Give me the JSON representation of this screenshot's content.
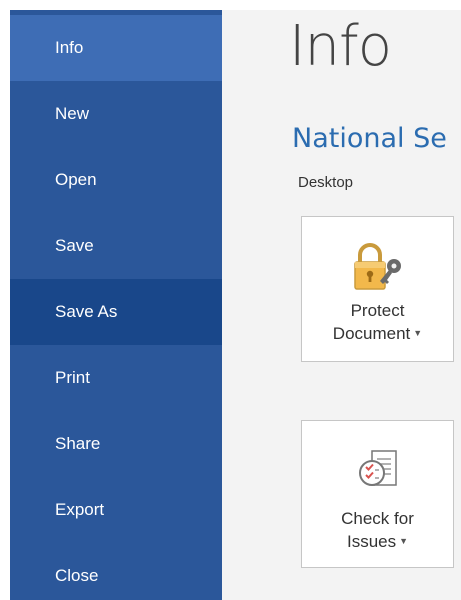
{
  "sidebar": {
    "items": [
      {
        "label": "Info"
      },
      {
        "label": "New"
      },
      {
        "label": "Open"
      },
      {
        "label": "Save"
      },
      {
        "label": "Save As"
      },
      {
        "label": "Print"
      },
      {
        "label": "Share"
      },
      {
        "label": "Export"
      },
      {
        "label": "Close"
      }
    ],
    "active_index": 0,
    "hover_index": 4
  },
  "main": {
    "title": "Info",
    "document_name": "National Se",
    "document_location": "Desktop",
    "tiles": [
      {
        "line1": "Protect",
        "line2": "Document",
        "icon": "lock-key-icon",
        "has_dropdown": true
      },
      {
        "line1": "Check for",
        "line2": "Issues",
        "icon": "inspect-document-icon",
        "has_dropdown": true
      }
    ]
  },
  "colors": {
    "sidebar_bg": "#2b579a",
    "sidebar_active": "#3e6db5",
    "sidebar_hover": "#19478a",
    "main_bg": "#f3f3f3",
    "accent_text": "#2b6cb0"
  }
}
